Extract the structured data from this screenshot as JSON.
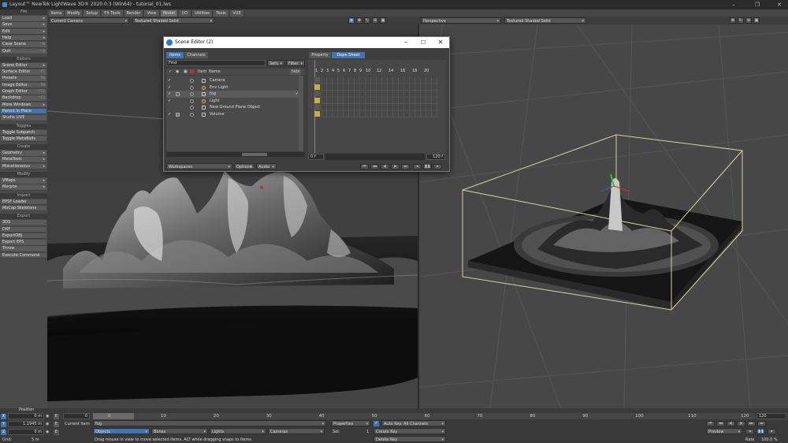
{
  "window": {
    "title": "Layout™ NewTek LightWave 3D® 2020.0.3 (Win64) - tutorial_01.lws"
  },
  "left_panel": {
    "sections": [
      {
        "header": "File",
        "items": [
          {
            "label": "Load",
            "dd": "▸"
          },
          {
            "label": "Save",
            "dd": "▸"
          },
          {
            "label": "Edit",
            "dd": "▸"
          },
          {
            "label": "Help",
            "dd": "▸"
          },
          {
            "label": "Clear Scene",
            "sc": "^N"
          },
          {
            "label": "Quit",
            "sc": "^Q"
          }
        ]
      },
      {
        "header": "Editors",
        "items": [
          {
            "label": "Scene Editor",
            "dd": "▸"
          },
          {
            "label": "Surface Editor",
            "sc": "F5"
          },
          {
            "label": "Presets",
            "sc": "F8"
          },
          {
            "label": "Image Editor",
            "sc": "F6"
          },
          {
            "label": "Graph Editor",
            "sc": "^F2"
          },
          {
            "label": "Backdrop",
            "sc": "^F5"
          },
          {
            "label": "More Windows",
            "dd": "▸"
          },
          {
            "label": "Parent in Place",
            "active": true
          },
          {
            "label": "Studio LIVE"
          }
        ]
      },
      {
        "header": "Toggles",
        "items": [
          {
            "label": "Toggle Subpatch"
          },
          {
            "label": "Toggle MetaBalls"
          }
        ]
      },
      {
        "header": "Create",
        "items": [
          {
            "label": "Geometry",
            "dd": "▸"
          },
          {
            "label": "MetaTools",
            "dd": "▸"
          },
          {
            "label": "Miscellaneous",
            "dd": "▸"
          }
        ]
      },
      {
        "header": "Modify",
        "items": [
          {
            "label": "VMaps",
            "dd": "▸"
          },
          {
            "label": "Morphs",
            "dd": "▸"
          }
        ]
      },
      {
        "header": "Import",
        "items": [
          {
            "label": "EPSF Loader"
          },
          {
            "label": "MoCap Skeletons"
          }
        ]
      },
      {
        "header": "Export",
        "items": [
          {
            "label": "3DS"
          },
          {
            "label": "DXF"
          },
          {
            "label": "ExportOBJ"
          },
          {
            "label": "Export EPS"
          },
          {
            "label": "Throw"
          },
          {
            "label": "Execute Command"
          }
        ]
      }
    ],
    "position": "Position",
    "x_label": "X",
    "y_label": "Y",
    "z_label": "Z",
    "x_value": "0 m",
    "y_value": "1.1945 m",
    "z_value": "0 m",
    "grid_label": "Grid:",
    "grid_value": "5 m"
  },
  "menu_tabs": [
    "Items",
    "Modify",
    "Setup",
    "FX Tools",
    "Render",
    "View",
    "Model",
    "I/O",
    "Utilities",
    "Tools",
    "VUE"
  ],
  "active_tab": "Model",
  "viewport_left": {
    "camera": "Current Camera",
    "shading": "Textured Shaded Solid"
  },
  "viewport_right": {
    "view": "Perspective",
    "shading": "Textured Shaded Solid"
  },
  "scene_editor": {
    "title": "Scene Editor (2)",
    "tabs_left": [
      "Items",
      "Channels"
    ],
    "tabs_right": [
      "Property",
      "Dope Sheet"
    ],
    "find": "Find",
    "sets": "Sets",
    "filter": "Filter",
    "col_item": "Item",
    "col_name": "Name",
    "hide": "hide",
    "rows": [
      {
        "name": "Camera",
        "check": "✓"
      },
      {
        "name": "Env Light",
        "check": "✓"
      },
      {
        "name": "fog",
        "check": "✓"
      },
      {
        "name": "Light",
        "check": "✓"
      },
      {
        "name": "New Ground Plane Object",
        "check": ""
      },
      {
        "name": "Volume",
        "check": "✓"
      }
    ],
    "ds_numbers": [
      "1",
      "2",
      "3",
      "4",
      "5",
      "6",
      "7",
      "8",
      "9",
      "10",
      "12",
      "14",
      "16",
      "18",
      "20"
    ],
    "frame_start": "0 f",
    "frame_end": "120 f",
    "workspaces": "Workspaces",
    "options": "Options...",
    "audio": "Audio"
  },
  "timeline": {
    "ticks": [
      "0",
      "10",
      "20",
      "30",
      "40",
      "50",
      "60",
      "70",
      "80",
      "90",
      "100",
      "110",
      "120"
    ],
    "end_field": "120",
    "current_item_label": "Current Item",
    "current_item_value": "fog",
    "properties": "Properties",
    "auto_key_label": "Auto Key: All Channels",
    "sel_label": "Sel:",
    "sel_value": "1",
    "create_key": "Create Key",
    "delete_key": "Delete Key",
    "objects": "Objects",
    "bones": "Bones",
    "lights": "Lights",
    "cameras": "Cameras",
    "preview": "Preview",
    "rate_label": "Rate",
    "rate_value": "100.0 %",
    "status": "Drag mouse in view to move selected items. ALT while dragging snaps to items."
  }
}
